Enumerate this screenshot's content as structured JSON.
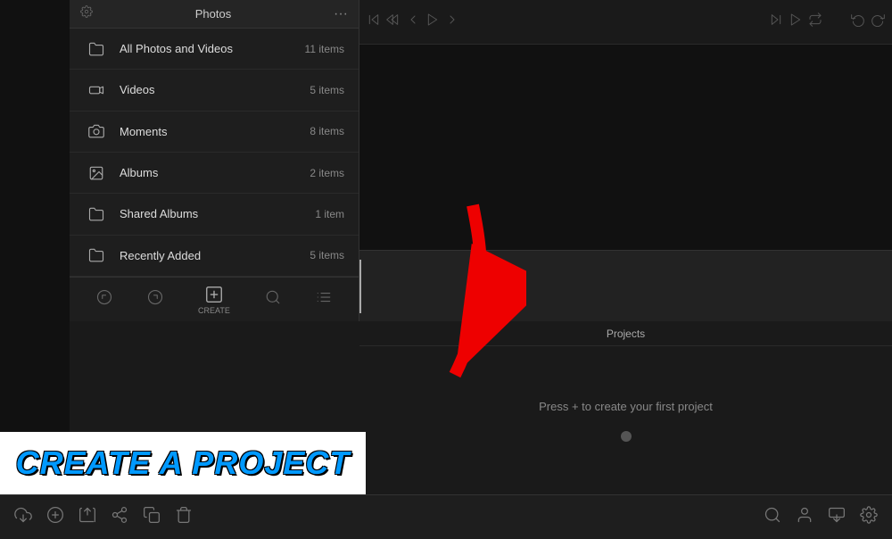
{
  "sidebar": {
    "header": {
      "title": "Photos",
      "settings_icon": "gear",
      "more_icon": "ellipsis"
    },
    "items": [
      {
        "id": "all-photos",
        "icon": "folder",
        "label": "All Photos and Videos",
        "count": "11 items"
      },
      {
        "id": "videos",
        "icon": "video",
        "label": "Videos",
        "count": "5 items"
      },
      {
        "id": "moments",
        "icon": "camera",
        "label": "Moments",
        "count": "8 items"
      },
      {
        "id": "albums",
        "icon": "album",
        "label": "Albums",
        "count": "2 items"
      },
      {
        "id": "shared-albums",
        "icon": "folder",
        "label": "Shared Albums",
        "count": "1 item"
      },
      {
        "id": "recently-added",
        "icon": "folder",
        "label": "Recently Added",
        "count": "5 items"
      }
    ],
    "toolbar": {
      "undo_icon": "undo",
      "redo_icon": "redo",
      "create_label": "CREATE",
      "search_icon": "search",
      "list_icon": "list"
    }
  },
  "main": {
    "toolbar": {
      "buttons": [
        "skip-back",
        "step-back",
        "back",
        "play",
        "forward",
        "step-forward",
        "skip-forward",
        "undo",
        "redo"
      ]
    },
    "projects": {
      "tab_label": "Projects",
      "empty_text": "Press + to create your first project"
    }
  },
  "bottom_toolbar": {
    "left_buttons": [
      "import",
      "add",
      "export",
      "share",
      "duplicate",
      "delete"
    ],
    "right_buttons": [
      "search",
      "user",
      "download",
      "settings"
    ]
  },
  "annotation": {
    "banner_text": "CREATE A PROJECT"
  }
}
